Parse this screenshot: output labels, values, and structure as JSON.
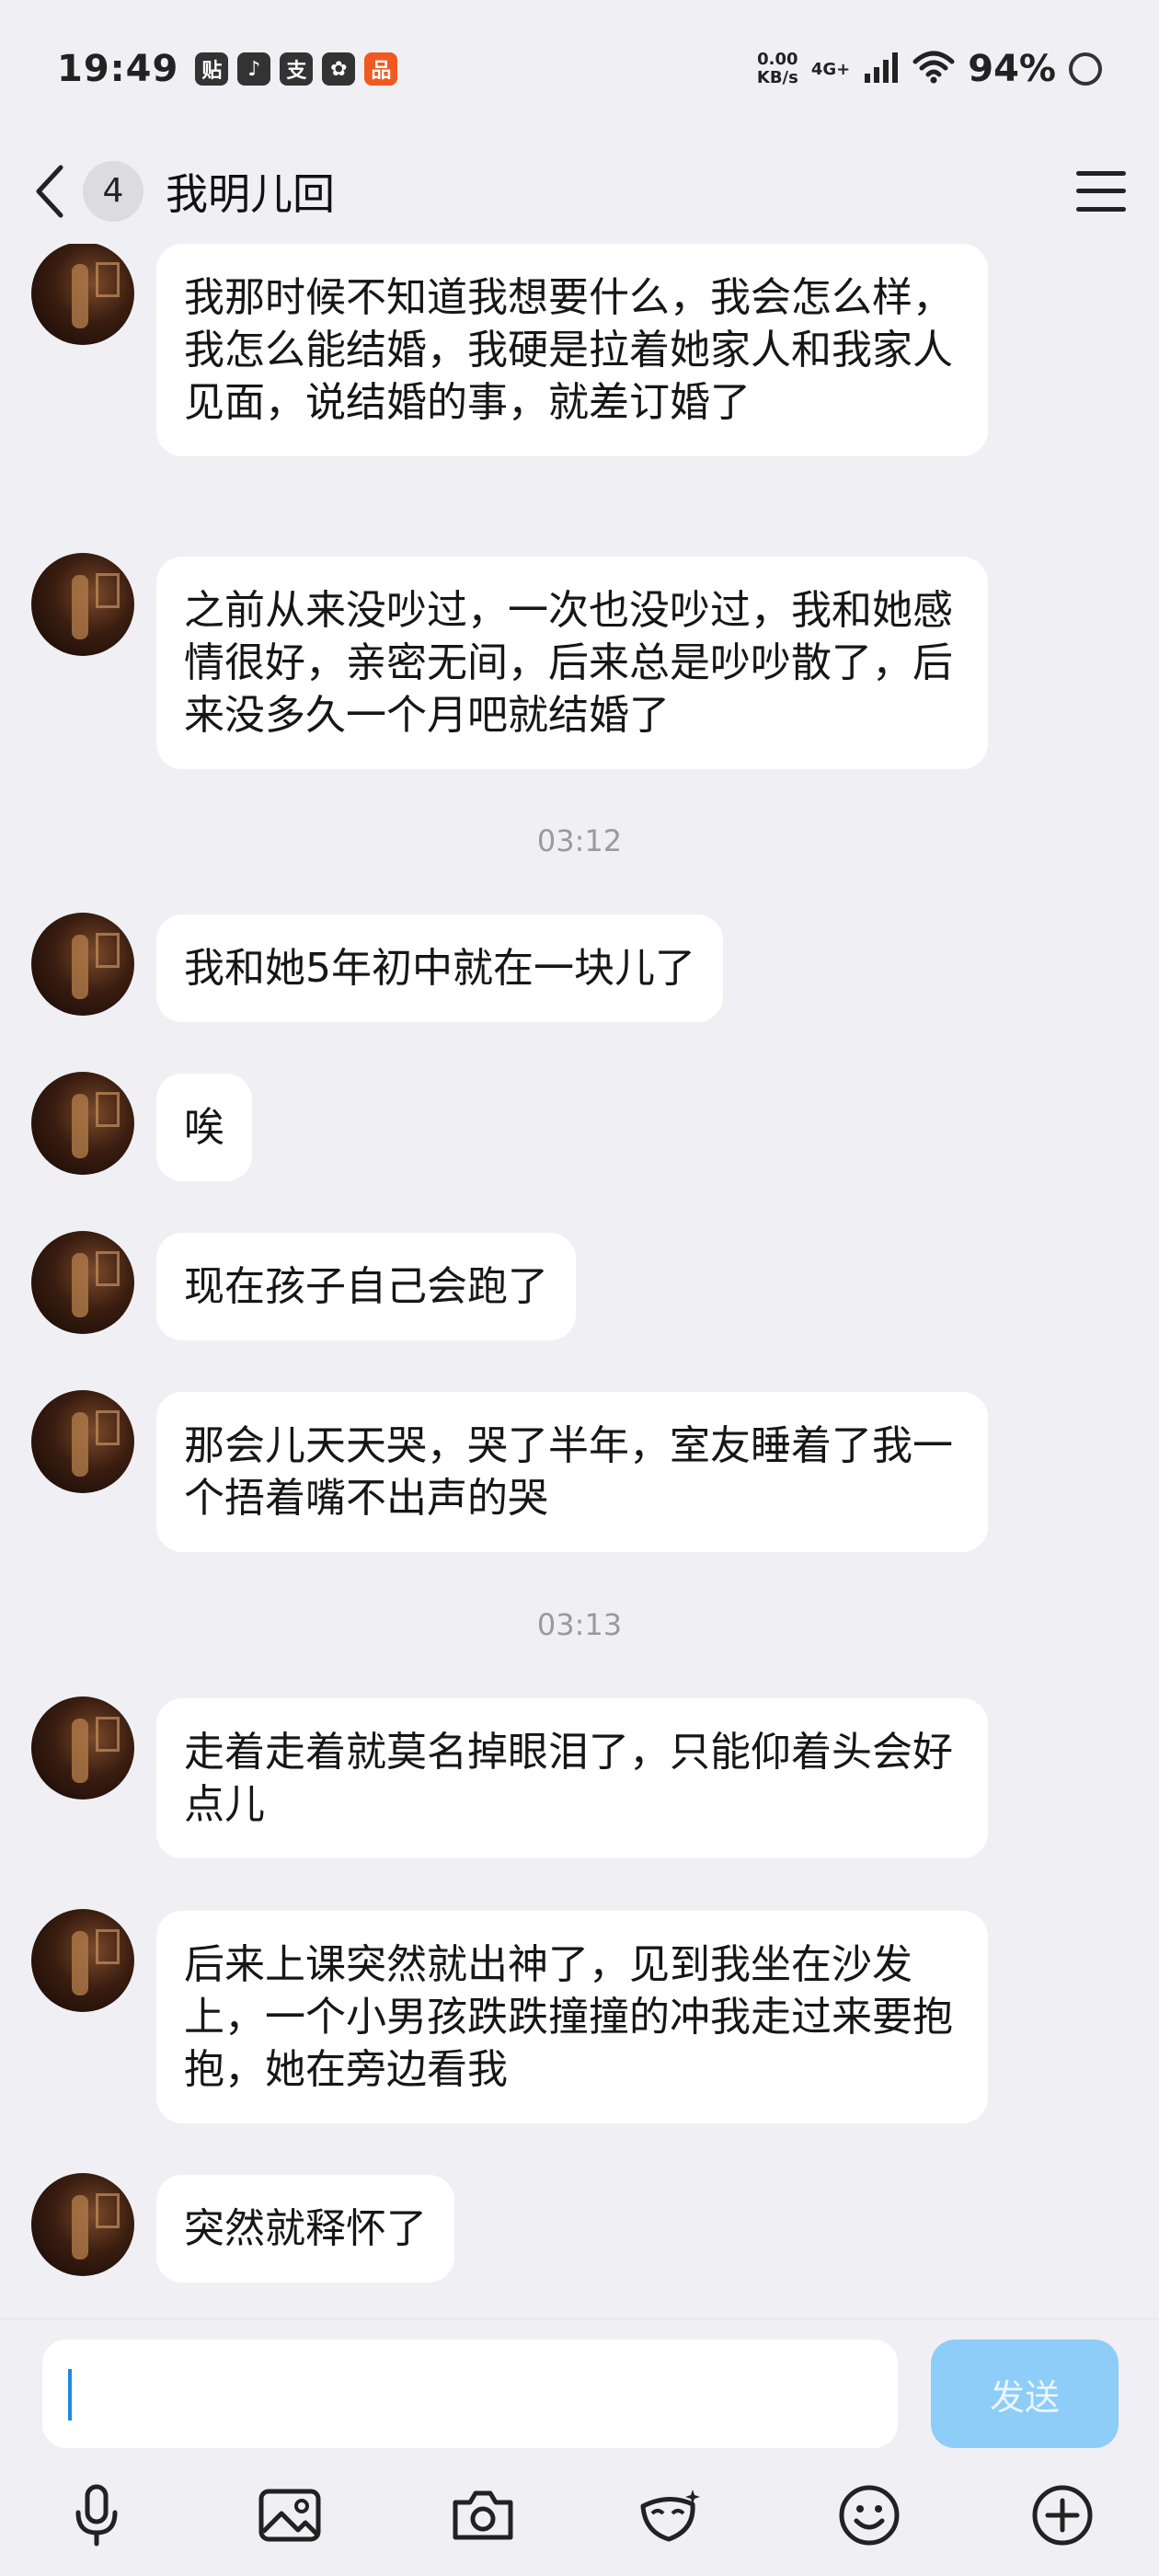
{
  "status_bar": {
    "time": "19:49",
    "apps": [
      "贴",
      "♪",
      "支",
      "✿",
      "品"
    ],
    "net_speed_value": "0.00",
    "net_speed_unit": "KB/s",
    "network": "4G+",
    "battery": "94%"
  },
  "header": {
    "unread_count": "4",
    "title": "我明儿回"
  },
  "messages": [
    {
      "text": "我那时候不知道我想要什么，我会怎么样，我怎么能结婚，我硬是拉着她家人和我家人见面，说结婚的事，就差订婚了"
    },
    {
      "text": "之前从来没吵过，一次也没吵过，我和她感情很好，亲密无间，后来总是吵吵散了，后来没多久一个月吧就结婚了"
    },
    {
      "text": "我和她5年初中就在一块儿了"
    },
    {
      "text": "唉"
    },
    {
      "text": "现在孩子自己会跑了"
    },
    {
      "text": "那会儿天天哭，哭了半年，室友睡着了我一个捂着嘴不出声的哭"
    },
    {
      "text": "走着走着就莫名掉眼泪了，只能仰着头会好点儿"
    },
    {
      "text": "后来上课突然就出神了，见到我坐在沙发上，一个小男孩跌跌撞撞的冲我走过来要抱抱，她在旁边看我"
    },
    {
      "text": "突然就释怀了"
    }
  ],
  "timestamps": [
    "03:12",
    "03:13"
  ],
  "input": {
    "value": "",
    "send_label": "发送"
  },
  "toolbar": [
    "microphone-icon",
    "image-icon",
    "camera-icon",
    "mask-icon",
    "emoji-icon",
    "plus-icon"
  ],
  "colors": {
    "background": "#f0f0f4",
    "bubble": "#ffffff",
    "send_button": "#8dcdf8",
    "caret": "#1e88e5"
  }
}
